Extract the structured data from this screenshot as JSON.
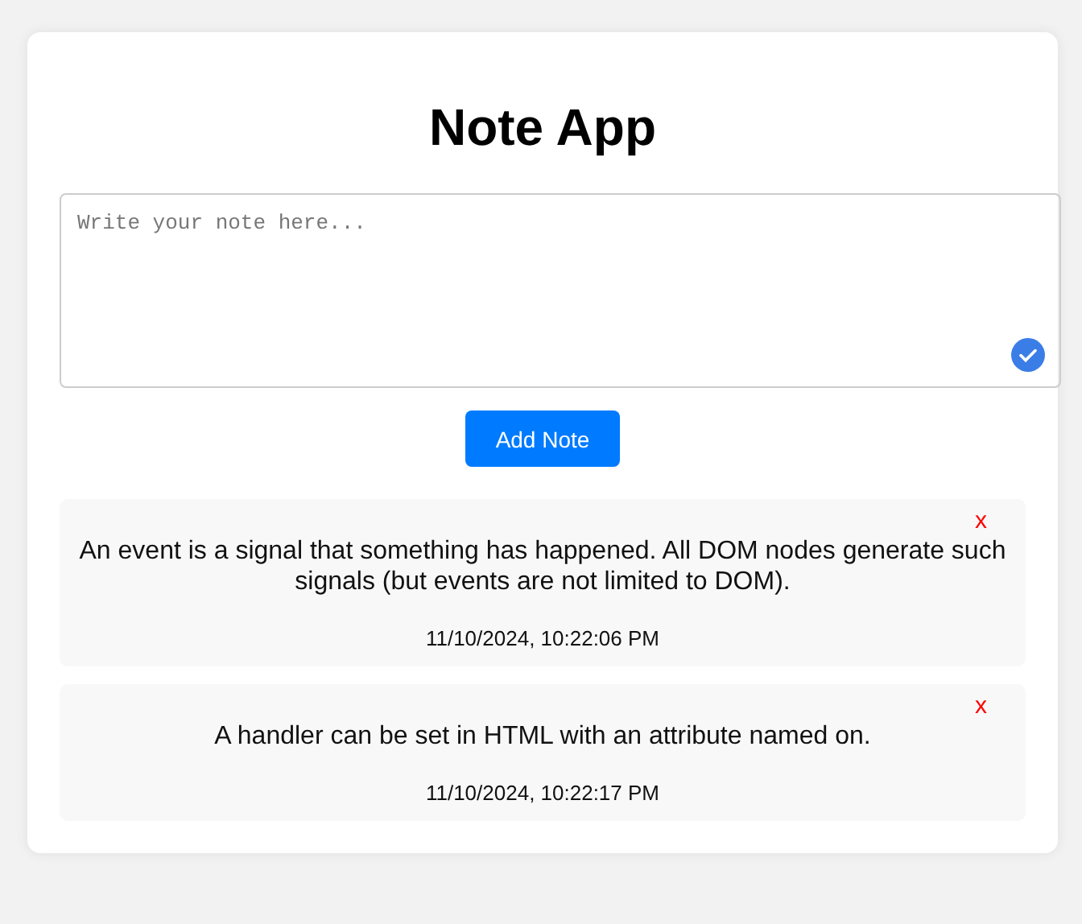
{
  "title": "Note App",
  "note_input": {
    "placeholder": "Write your note here..."
  },
  "add_button": "Add Note",
  "notes": [
    {
      "text": "An event is a signal that something has happened. All DOM nodes generate such signals (but events are not limited to DOM).",
      "timestamp": "11/10/2024, 10:22:06 PM",
      "delete": "x"
    },
    {
      "text": "A handler can be set in HTML with an attribute named on.",
      "timestamp": "11/10/2024, 10:22:17 PM",
      "delete": "x"
    }
  ]
}
